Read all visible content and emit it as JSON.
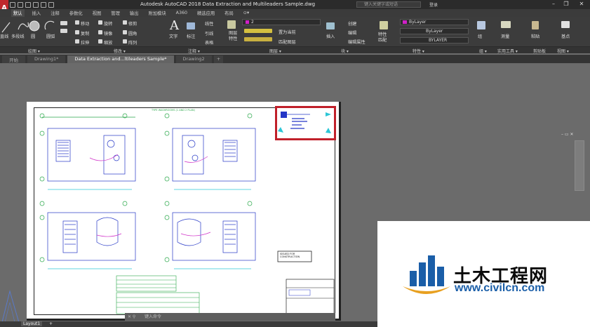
{
  "app": {
    "title": "Autodesk AutoCAD 2018   Data Extraction and Multileaders Sample.dwg",
    "search_placeholder": "键入关键字或短语",
    "login_label": "登录",
    "logo_letter": "A"
  },
  "ribbon_tabs": [
    "默认",
    "插入",
    "注释",
    "参数化",
    "视图",
    "管理",
    "输出",
    "附加模块",
    "A360",
    "精选应用",
    "布局",
    "⊙▾"
  ],
  "ribbon": {
    "draw": {
      "line": "直线",
      "polyline": "多段线",
      "circle": "圆",
      "arc": "圆弧"
    },
    "modify": {
      "move": "移动",
      "rotate": "旋转",
      "trim": "修剪",
      "copy": "复制",
      "mirror": "镜像",
      "fillet": "圆角",
      "stretch": "拉伸",
      "scale": "缩放",
      "array": "阵列"
    },
    "annotation": {
      "text": "文字",
      "dimension": "标注",
      "linear": "线性",
      "leader": "引线",
      "table": "表格"
    },
    "layers": {
      "properties": "图层\n特性",
      "current_layer": "2",
      "make_current": "置为当前",
      "match_layer": "匹配图层"
    },
    "block": {
      "insert": "插入",
      "create": "创建",
      "edit": "编辑",
      "edit_attributes": "编辑属性"
    },
    "properties": {
      "match": "特性\n匹配",
      "color": "ByLayer",
      "linetype": "ByLayer",
      "lineweight": "BYLAYER"
    },
    "groups": {
      "group": "组"
    },
    "utilities": {
      "measure": "测量"
    },
    "clipboard": {
      "paste": "粘贴"
    },
    "view": {
      "base": "基点"
    }
  },
  "panels": [
    "绘图 ▾",
    "修改 ▾",
    "注释 ▾",
    "图层 ▾",
    "块 ▾",
    "特性 ▾",
    "组 ▾",
    "实用工具 ▾",
    "剪贴板",
    "视图 ▾"
  ],
  "doc_tabs": [
    "开始",
    "Drawing1*",
    "Data Extraction and...ltileaders Sample*",
    "Drawing2",
    "+"
  ],
  "layout_tabs": [
    "Layout1",
    "+"
  ],
  "command_line": "键入命令",
  "drawing": {
    "plan_title": "TYPE WASHROOMS (1 AND 2 PLAN)",
    "issued": "ISSUED FOR\nCONSTRUCTION"
  },
  "watermark": {
    "brand_cn": "土木工程网",
    "url": "www.civilcn.com"
  }
}
